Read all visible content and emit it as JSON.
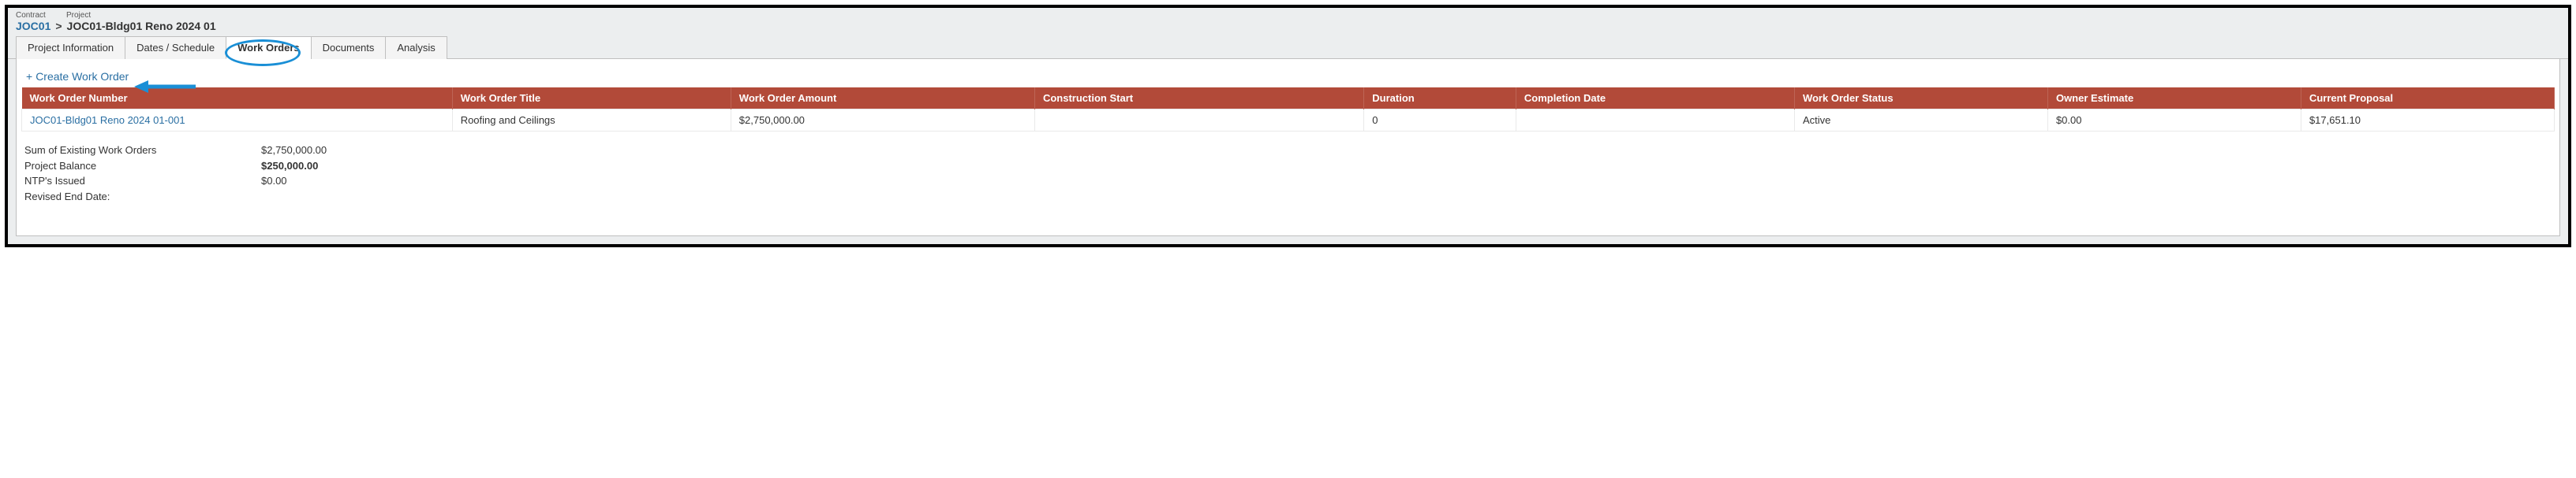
{
  "breadcrumb": {
    "contract_label": "Contract",
    "project_label": "Project",
    "contract": "JOC01",
    "separator": ">",
    "project": "JOC01-Bldg01 Reno 2024 01"
  },
  "tabs": {
    "info": "Project Information",
    "dates": "Dates / Schedule",
    "work_orders": "Work Orders",
    "documents": "Documents",
    "analysis": "Analysis"
  },
  "actions": {
    "create_work_order": "Create Work Order",
    "plus": "+"
  },
  "table": {
    "headers": {
      "number": "Work Order Number",
      "title": "Work Order Title",
      "amount": "Work Order Amount",
      "cstart": "Construction Start",
      "duration": "Duration",
      "cdate": "Completion Date",
      "status": "Work Order Status",
      "owner": "Owner Estimate",
      "proposal": "Current Proposal"
    },
    "rows": [
      {
        "number": "JOC01-Bldg01 Reno 2024 01-001",
        "title": "Roofing and Ceilings",
        "amount": "$2,750,000.00",
        "cstart": "",
        "duration": "0",
        "cdate": "",
        "status": "Active",
        "owner": "$0.00",
        "proposal": "$17,651.10"
      }
    ]
  },
  "summary": {
    "sum_label": "Sum of Existing Work Orders",
    "sum_value": "$2,750,000.00",
    "balance_label": "Project Balance",
    "balance_value": "$250,000.00",
    "ntp_label": "NTP's Issued",
    "ntp_value": "$0.00",
    "revised_label": "Revised End Date:",
    "revised_value": ""
  }
}
